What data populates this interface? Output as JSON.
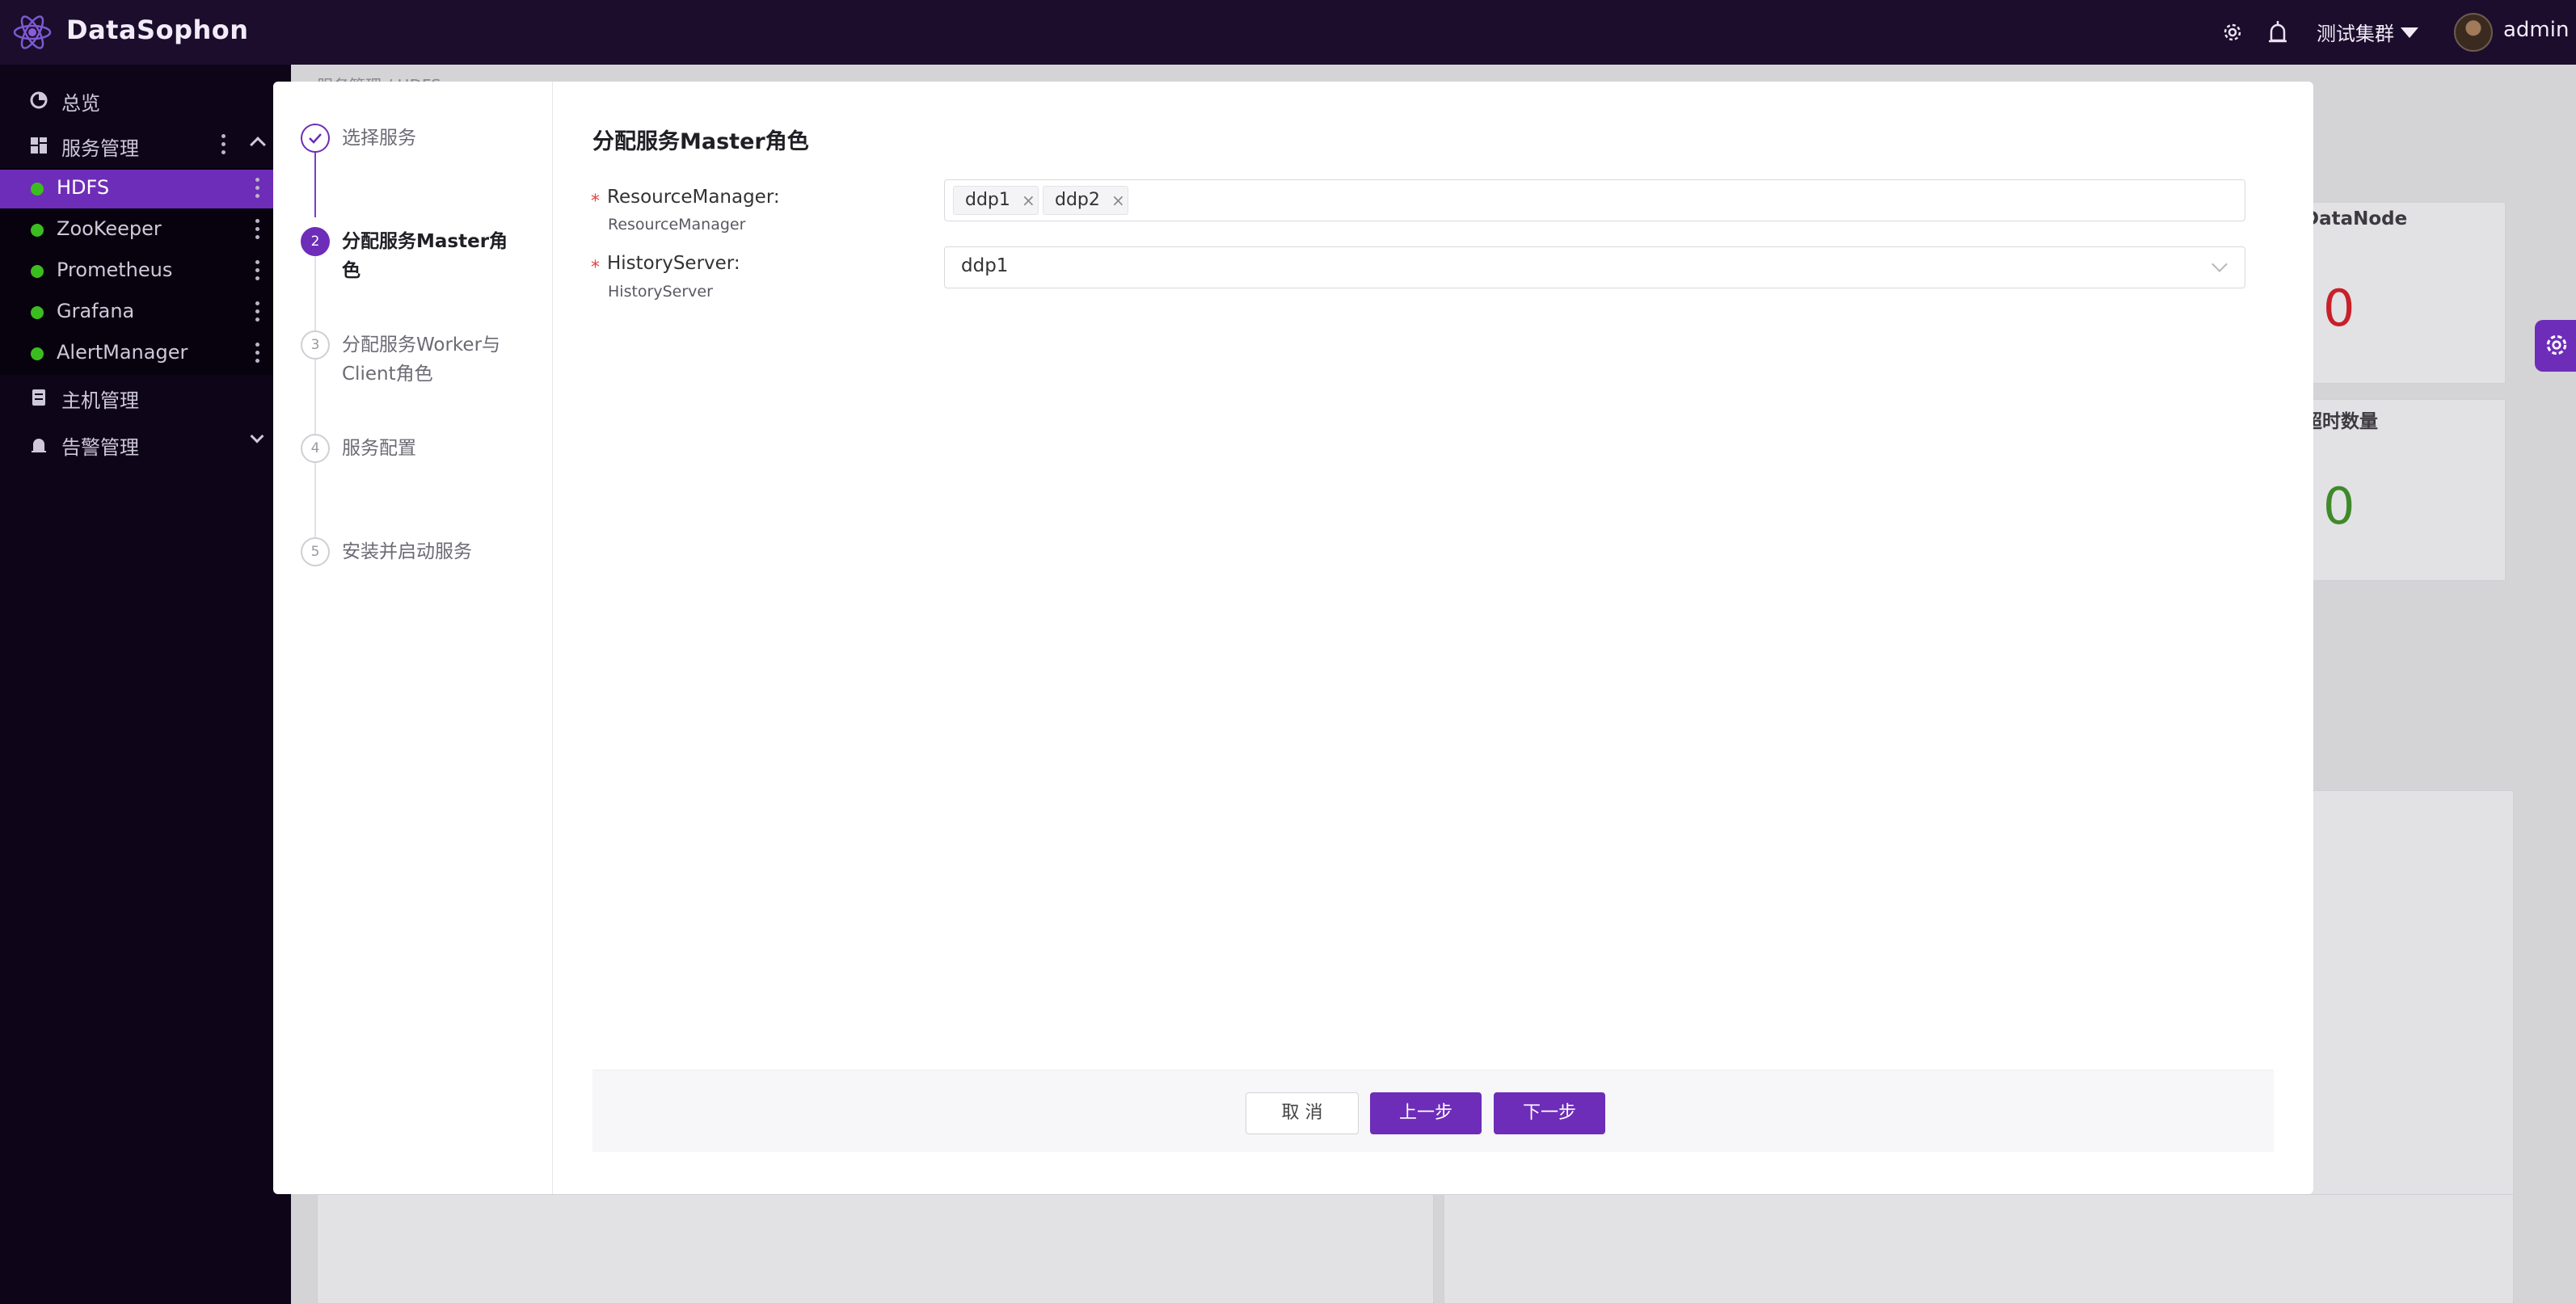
{
  "app": {
    "title": "DataSophon"
  },
  "header": {
    "cluster_name": "测试集群",
    "username": "admin"
  },
  "sidebar": {
    "items": [
      {
        "label": "总览"
      },
      {
        "label": "服务管理"
      },
      {
        "label": "主机管理"
      },
      {
        "label": "告警管理"
      }
    ],
    "services": [
      {
        "label": "HDFS",
        "status": "running",
        "active": true
      },
      {
        "label": "ZooKeeper",
        "status": "running"
      },
      {
        "label": "Prometheus",
        "status": "running"
      },
      {
        "label": "Grafana",
        "status": "running"
      },
      {
        "label": "AlertManager",
        "status": "running"
      }
    ]
  },
  "background": {
    "breadcrumb": "服务管理 / HDFS",
    "card1_label": "DataNode",
    "card1_value": "0",
    "card2_label": "超时数量",
    "card2_value": "0"
  },
  "wizard": {
    "steps": [
      {
        "index": "1",
        "title": "选择服务",
        "state": "finished"
      },
      {
        "index": "2",
        "title": "分配服务Master角色",
        "state": "current"
      },
      {
        "index": "3",
        "title": "分配服务Worker与Client角色",
        "state": "waiting"
      },
      {
        "index": "4",
        "title": "服务配置",
        "state": "waiting"
      },
      {
        "index": "5",
        "title": "安装并启动服务",
        "state": "waiting"
      }
    ],
    "form_title": "分配服务Master角色",
    "fields": [
      {
        "label": "ResourceManager:",
        "sublabel": "ResourceManager",
        "type": "multi-select",
        "values": [
          "ddp1",
          "ddp2"
        ]
      },
      {
        "label": "HistoryServer:",
        "sublabel": "HistoryServer",
        "type": "select",
        "value": "ddp1"
      }
    ],
    "buttons": {
      "cancel": "取 消",
      "prev": "上一步",
      "next": "下一步"
    }
  },
  "colors": {
    "primary": "#6e2db8",
    "header_bg": "#1c0d2d",
    "sidebar_bg": "#0f0519",
    "status_green": "#3bbd1f",
    "danger_red": "#c8202a"
  }
}
